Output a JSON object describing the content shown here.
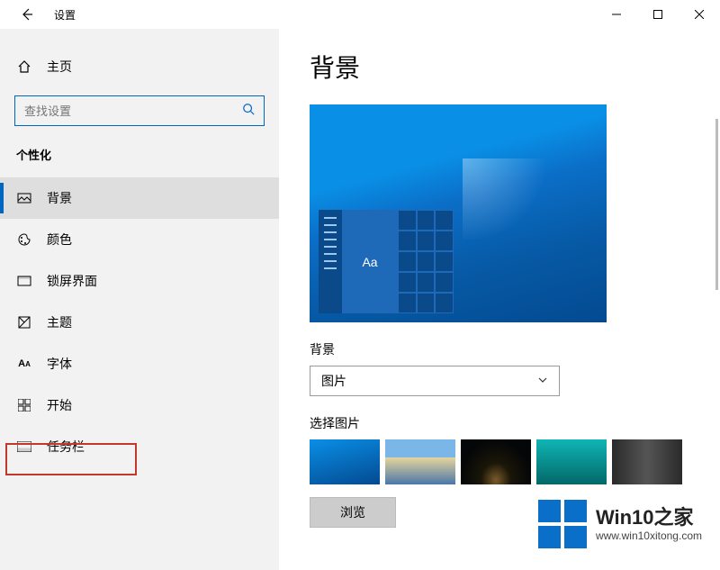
{
  "titlebar": {
    "title": "设置"
  },
  "sidebar": {
    "home_label": "主页",
    "search_placeholder": "查找设置",
    "section_title": "个性化",
    "items": [
      {
        "label": "背景"
      },
      {
        "label": "颜色"
      },
      {
        "label": "锁屏界面"
      },
      {
        "label": "主题"
      },
      {
        "label": "字体"
      },
      {
        "label": "开始"
      },
      {
        "label": "任务栏"
      }
    ],
    "active_index": 0,
    "highlighted_index": 6
  },
  "content": {
    "page_title": "背景",
    "preview_sample_text": "Aa",
    "bg_label": "背景",
    "bg_dropdown_value": "图片",
    "choose_picture_label": "选择图片",
    "browse_button_label": "浏览"
  },
  "watermark": {
    "title": "Win10之家",
    "url": "www.win10xitong.com"
  }
}
